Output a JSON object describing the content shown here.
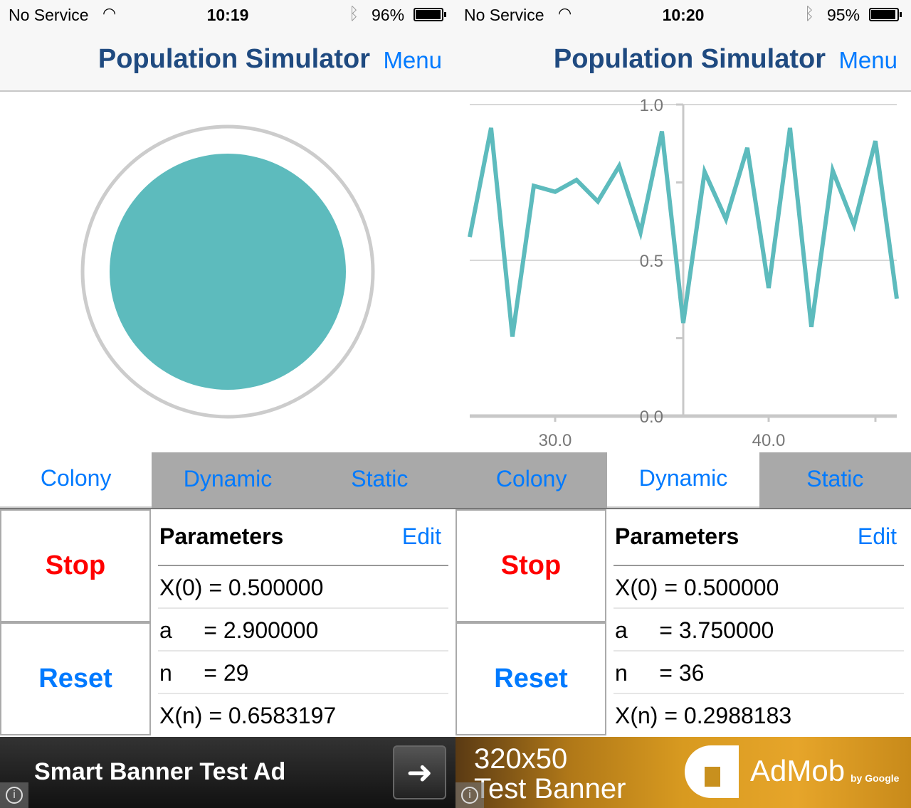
{
  "accent_color": "#007aff",
  "series_color": "#5dbbbd",
  "screens": [
    {
      "status": {
        "carrier": "No Service",
        "time": "10:19",
        "battery": "96%",
        "battery_level": 0.96
      },
      "nav": {
        "title": "Population Simulator",
        "menu": "Menu"
      },
      "view": "colony",
      "tabs": [
        {
          "label": "Colony",
          "selected": true
        },
        {
          "label": "Dynamic",
          "selected": false
        },
        {
          "label": "Static",
          "selected": false
        }
      ],
      "controls": {
        "stop": "Stop",
        "reset": "Reset"
      },
      "params": {
        "header": "Parameters",
        "edit": "Edit",
        "rows": [
          "X(0) = 0.500000",
          "a     = 2.900000",
          "n     = 29",
          "X(n) = 0.6583197"
        ]
      },
      "ad": {
        "text": "Smart Banner Test Ad",
        "arrow_icon": "arrow-right-icon",
        "info_icon": "info-icon"
      }
    },
    {
      "status": {
        "carrier": "No Service",
        "time": "10:20",
        "battery": "95%",
        "battery_level": 0.95
      },
      "nav": {
        "title": "Population Simulator",
        "menu": "Menu"
      },
      "view": "dynamic",
      "tabs": [
        {
          "label": "Colony",
          "selected": false
        },
        {
          "label": "Dynamic",
          "selected": true
        },
        {
          "label": "Static",
          "selected": false
        }
      ],
      "controls": {
        "stop": "Stop",
        "reset": "Reset"
      },
      "params": {
        "header": "Parameters",
        "edit": "Edit",
        "rows": [
          "X(0) = 0.500000",
          "a     = 3.750000",
          "n     = 36",
          "X(n) = 0.2988183"
        ]
      },
      "ad": {
        "line1": "320x50",
        "line2": "Test Banner",
        "brand": "AdMob",
        "by": "by Google",
        "info_icon": "info-icon"
      }
    }
  ],
  "chart_data": {
    "type": "line",
    "x": [
      26,
      27,
      28,
      29,
      30,
      31,
      32,
      33,
      34,
      35,
      36,
      37,
      38,
      39,
      40,
      41,
      42,
      43,
      44,
      45,
      46
    ],
    "values": [
      0.575,
      0.925,
      0.255,
      0.739,
      0.72,
      0.758,
      0.689,
      0.803,
      0.59,
      0.914,
      0.299,
      0.784,
      0.632,
      0.861,
      0.411,
      0.925,
      0.286,
      0.788,
      0.613,
      0.883,
      0.377
    ],
    "xlim": [
      26,
      46
    ],
    "ylim": [
      0,
      1
    ],
    "x_ticks": [
      30,
      40
    ],
    "x_tick_labels": [
      "30.0",
      "40.0"
    ],
    "y_ticks": [
      0,
      0.5,
      1
    ],
    "y_tick_labels": [
      "0.0",
      "0.5",
      "1.0"
    ],
    "y_axis_at_x": 36,
    "grid": "horizontal",
    "color": "#5dbbbd"
  }
}
